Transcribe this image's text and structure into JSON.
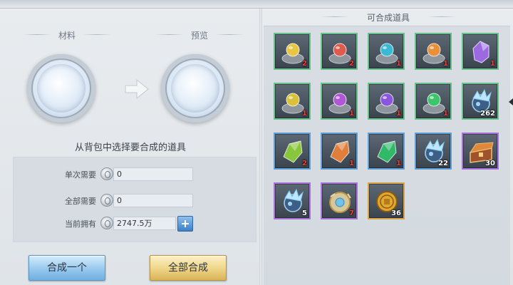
{
  "left": {
    "materials_title": "材料",
    "preview_title": "预览",
    "hint": "从背包中选择要合成的道具",
    "rows": [
      {
        "label": "单次需要",
        "value": "0"
      },
      {
        "label": "全部需要",
        "value": "0"
      },
      {
        "label": "当前拥有",
        "value": "2747.5万"
      }
    ],
    "buttons": {
      "craft_one": "合成一个",
      "craft_all": "全部合成"
    }
  },
  "right": {
    "title": "可合成道具",
    "items": [
      {
        "icon": "ore-gray-crystal-icon",
        "gem": "#e8c542",
        "count": "2",
        "count_color": "red",
        "rarity": "green"
      },
      {
        "icon": "ore-red-crystal-icon",
        "gem": "#e05a4e",
        "count": "2",
        "count_color": "red",
        "rarity": "green"
      },
      {
        "icon": "ore-cyan-crystal-icon",
        "gem": "#38b9d6",
        "count": "1",
        "count_color": "red",
        "rarity": "green"
      },
      {
        "icon": "ore-orange-crystal-icon",
        "gem": "#e8903a",
        "count": "1",
        "count_color": "red",
        "rarity": "green"
      },
      {
        "icon": "purple-crystal-icon",
        "gem": "#9b6ae0",
        "count": "1",
        "count_color": "red",
        "rarity": "green"
      },
      {
        "icon": "ore-yellow-crystal-icon",
        "gem": "#d9c23a",
        "count": "1",
        "count_color": "red",
        "rarity": "green"
      },
      {
        "icon": "ore-violet-crystal-icon",
        "gem": "#b056d6",
        "count": "1",
        "count_color": "red",
        "rarity": "green"
      },
      {
        "icon": "ore-purple-crystal-icon",
        "gem": "#8a56e0",
        "count": "1",
        "count_color": "red",
        "rarity": "green"
      },
      {
        "icon": "ore-green-crystal-icon",
        "gem": "#3ec46a",
        "count": "1",
        "count_color": "red",
        "rarity": "green"
      },
      {
        "icon": "ice-sphere-icon",
        "gem": "#7fc9f0",
        "count": "262",
        "count_color": "white",
        "rarity": "green"
      },
      {
        "icon": "green-shard-icon",
        "gem": "#8ccd3a",
        "count": "2",
        "count_color": "red",
        "rarity": "blue"
      },
      {
        "icon": "orange-shard-icon",
        "gem": "#e8823a",
        "count": "1",
        "count_color": "red",
        "rarity": "blue"
      },
      {
        "icon": "emerald-shard-icon",
        "gem": "#2fbf6a",
        "count": "1",
        "count_color": "red",
        "rarity": "blue"
      },
      {
        "icon": "ice-sphere-icon",
        "gem": "#7fc9f0",
        "count": "22",
        "count_color": "white",
        "rarity": "blue"
      },
      {
        "icon": "treasure-chest-icon",
        "gem": "#e0883a",
        "count": "30",
        "count_color": "white",
        "rarity": "purple"
      },
      {
        "icon": "ice-sphere-icon",
        "gem": "#7fc9f0",
        "count": "5",
        "count_color": "white",
        "rarity": "purple"
      },
      {
        "icon": "golden-disc-icon",
        "gem": "#d9b457",
        "count": "7",
        "count_color": "red",
        "rarity": "purple"
      },
      {
        "icon": "gold-coin-icon",
        "gem": "#e0a82e",
        "count": "36",
        "count_color": "white",
        "rarity": "gold"
      }
    ]
  }
}
